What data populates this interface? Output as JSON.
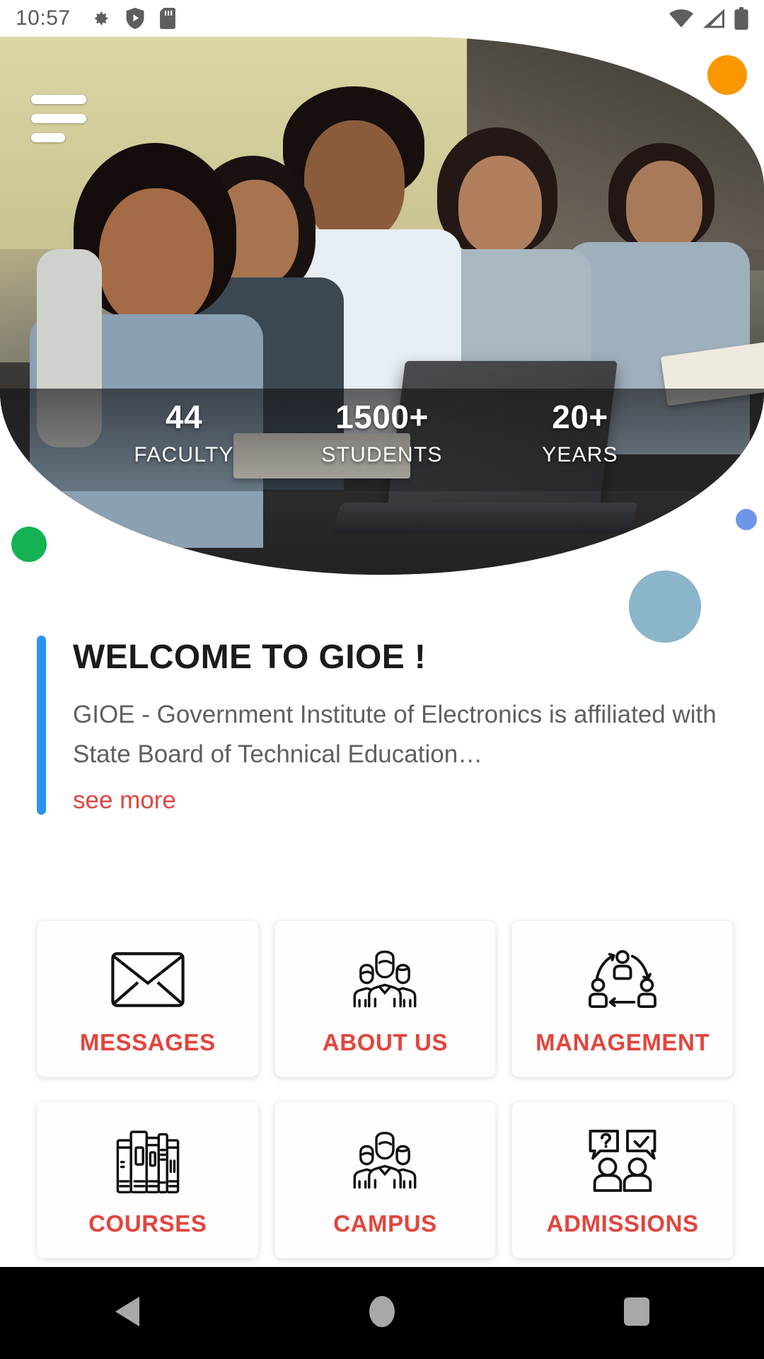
{
  "statusbar": {
    "time": "10:57",
    "left_icons": [
      "gear-icon",
      "shield-play-icon",
      "sd-card-icon"
    ],
    "right_icons": [
      "wifi-icon",
      "cell-signal-icon",
      "battery-icon"
    ]
  },
  "hero": {
    "menu_label": "hamburger-menu",
    "stats": [
      {
        "number": "44",
        "label": "FACULTY"
      },
      {
        "number": "1500+",
        "label": "STUDENTS"
      },
      {
        "number": "20+",
        "label": "YEARS"
      }
    ]
  },
  "decor": {
    "orange": "#FA9600",
    "green": "#14B254",
    "blue_small": "#6E96E8",
    "steel": "#8BB5C9"
  },
  "welcome": {
    "title": "WELCOME TO GIOE !",
    "body": "GIOE - Government Institute of Electronics is affiliated with State Board of Technical Education…",
    "see_more": "see more",
    "accent_color": "#2A93F0",
    "link_color": "#E2453D"
  },
  "grid": {
    "items": [
      {
        "label": "MESSAGES",
        "icon": "envelope-icon"
      },
      {
        "label": "ABOUT US",
        "icon": "people-group-icon"
      },
      {
        "label": "MANAGEMENT",
        "icon": "people-cycle-icon"
      },
      {
        "label": "COURSES",
        "icon": "books-icon"
      },
      {
        "label": "CAMPUS",
        "icon": "people-group-icon"
      },
      {
        "label": "ADMISSIONS",
        "icon": "people-speech-icon"
      }
    ],
    "label_color": "#E2453D"
  },
  "navbar": {
    "back": "back-triangle",
    "home": "home-circle",
    "recents": "recents-square"
  }
}
